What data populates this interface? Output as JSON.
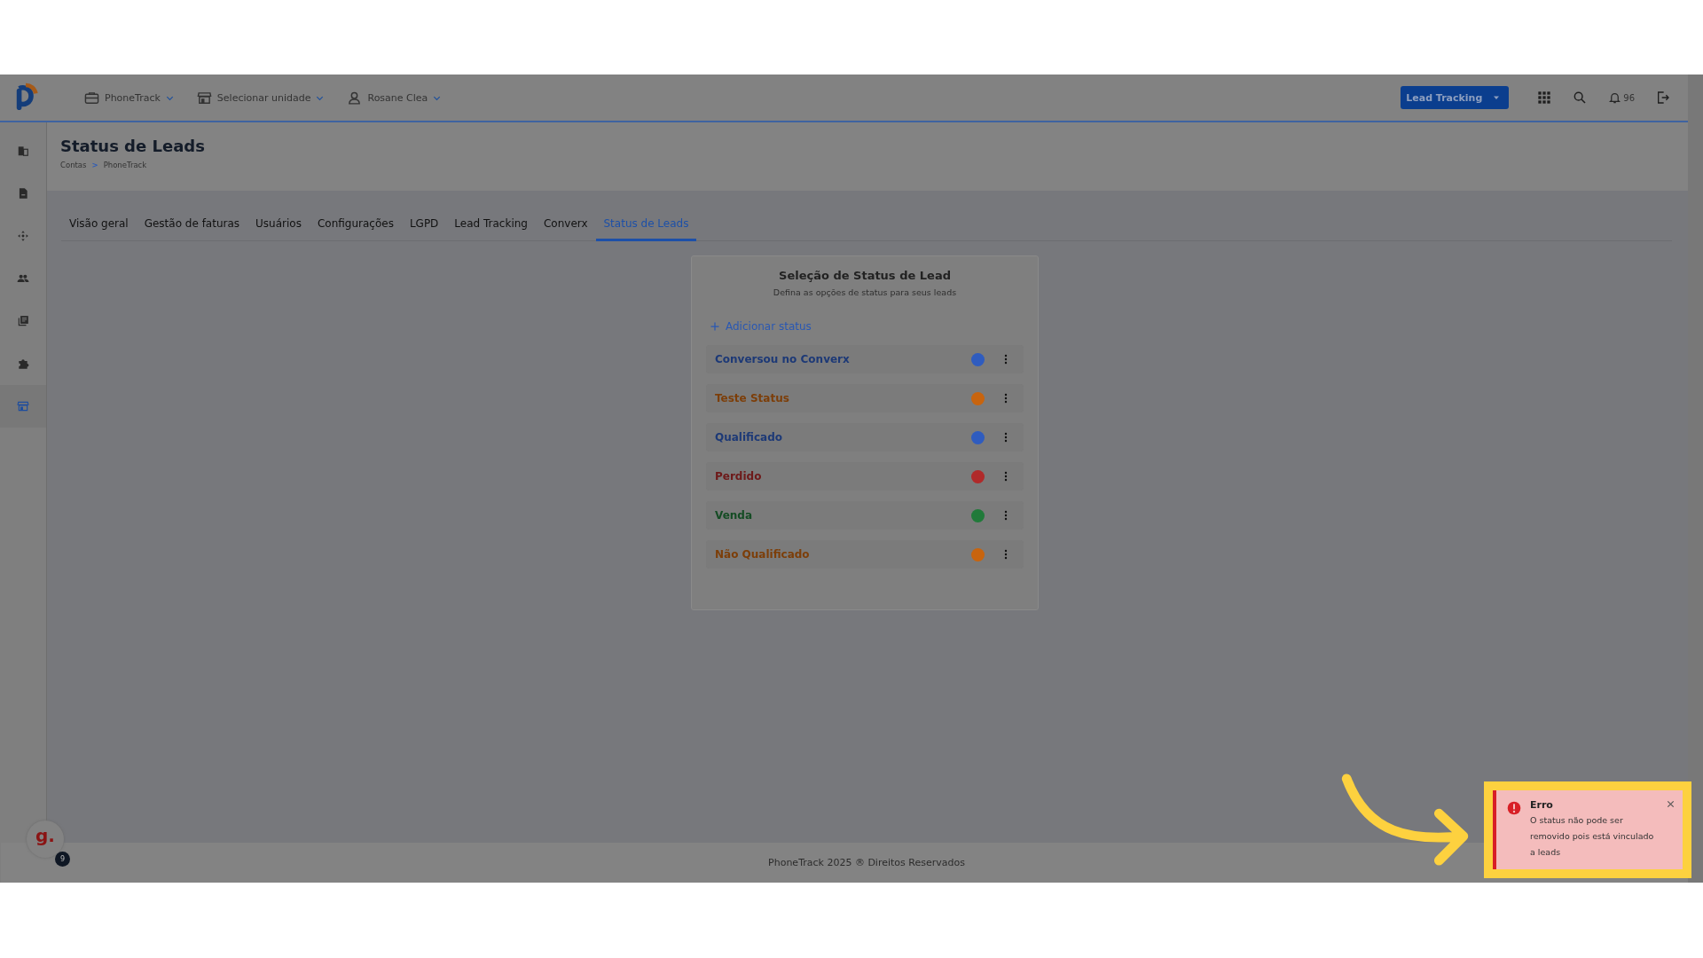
{
  "header": {
    "menus": [
      {
        "label": "PhoneTrack"
      },
      {
        "label": "Selecionar unidade"
      },
      {
        "label": "Rosane Clea"
      }
    ],
    "product_button": {
      "label": "Lead Tracking"
    },
    "notifications": "96"
  },
  "sidebar": {
    "items": [
      {
        "selected": false
      },
      {
        "selected": false
      },
      {
        "selected": false
      },
      {
        "selected": false
      },
      {
        "selected": false
      },
      {
        "selected": false
      },
      {
        "selected": true
      }
    ]
  },
  "page": {
    "title": "Status de Leads",
    "breadcrumb": [
      "Contas",
      "PhoneTrack"
    ],
    "breadcrumb_separator": ">"
  },
  "tabs": [
    {
      "label": "Visão geral",
      "selected": false
    },
    {
      "label": "Gestão de faturas",
      "selected": false
    },
    {
      "label": "Usuários",
      "selected": false
    },
    {
      "label": "Configurações",
      "selected": false
    },
    {
      "label": "LGPD",
      "selected": false
    },
    {
      "label": "Lead Tracking",
      "selected": false
    },
    {
      "label": "Converx",
      "selected": false
    },
    {
      "label": "Status de Leads",
      "selected": true
    }
  ],
  "card": {
    "title": "Seleção de Status de Lead",
    "subtitle": "Defina as opções de status para seus leads",
    "add_button": "Adicionar status",
    "statuses": [
      {
        "label": "Conversou no Converx",
        "color": "#2f5cbf"
      },
      {
        "label": "Teste Status",
        "color": "#c8640e"
      },
      {
        "label": "Qualificado",
        "color": "#2f5cbf"
      },
      {
        "label": "Perdido",
        "color": "#b02a2a"
      },
      {
        "label": "Venda",
        "color": "#217a3a"
      },
      {
        "label": "Não Qualificado",
        "color": "#c8640e"
      }
    ]
  },
  "chat": {
    "logo": "g.",
    "badge": "9"
  },
  "footer": {
    "text": "PhoneTrack 2025 ® Direitos Reservados"
  },
  "toast": {
    "title": "Erro",
    "message": "O status não pode ser removido pois está vinculado a leads",
    "highlighted": true
  }
}
